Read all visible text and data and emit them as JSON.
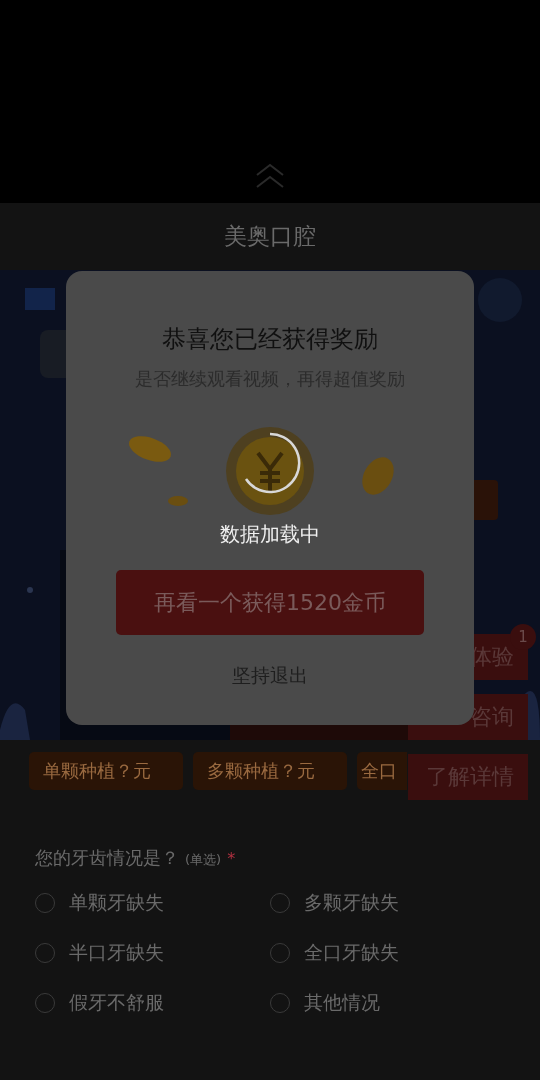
{
  "page_title": "美奥口腔",
  "price_buttons": [
    "单颗种植？元",
    "多颗种植？元",
    "全口"
  ],
  "float_buttons": [
    {
      "label": "体验",
      "badge": "1"
    },
    {
      "label": "咨询"
    },
    {
      "label": "了解详情"
    }
  ],
  "question": {
    "title": "您的牙齿情况是？",
    "hint": "(单选)",
    "required_mark": "*",
    "options": [
      {
        "label": "单颗牙缺失",
        "selected": false
      },
      {
        "label": "多颗牙缺失",
        "selected": false
      },
      {
        "label": "半口牙缺失",
        "selected": false
      },
      {
        "label": "全口牙缺失",
        "selected": false
      },
      {
        "label": "假牙不舒服",
        "selected": false
      },
      {
        "label": "其他情况",
        "selected": false
      }
    ]
  },
  "dialog": {
    "title": "恭喜您已经获得奖励",
    "subtitle": "是否继续观看视频，再得超值奖励",
    "loading": "数据加载中",
    "primary_button": "再看一个获得1520金币",
    "exit_link": "坚持退出"
  }
}
